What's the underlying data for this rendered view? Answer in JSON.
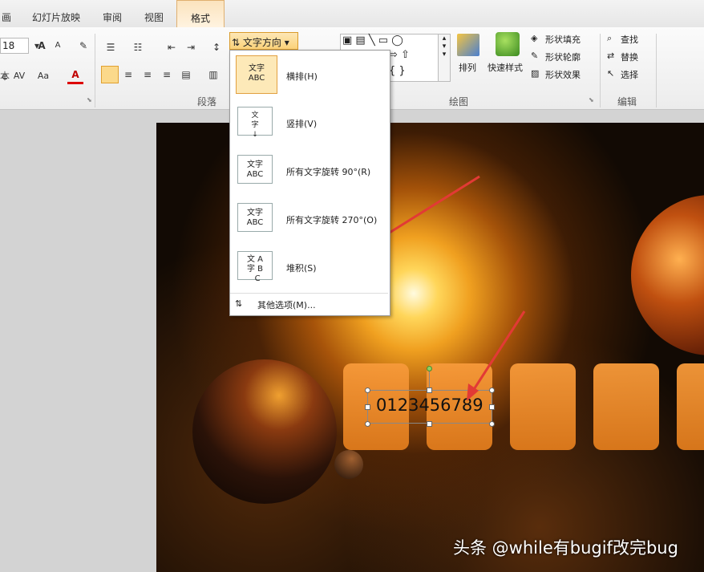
{
  "tabs": [
    "画",
    "幻灯片放映",
    "审阅",
    "视图",
    "格式"
  ],
  "font": {
    "size": "18"
  },
  "groups": {
    "font_partial": "本",
    "paragraph": "段落",
    "drawing": "绘图",
    "editing": "编辑"
  },
  "ribbon": {
    "text_direction": "文字方向",
    "arrange": "排列",
    "quick_styles": "快速样式",
    "shape_fill": "形状填充",
    "shape_outline": "形状轮廓",
    "shape_effects": "形状效果",
    "find": "查找",
    "replace": "替换",
    "select": "选择",
    "font_color_letter": "A",
    "case_label": "Aa"
  },
  "dropdown": {
    "items": [
      {
        "label": "横排(H)",
        "icon_text": "文字 ABC"
      },
      {
        "label": "竖排(V)",
        "icon_text": "文字"
      },
      {
        "label": "所有文字旋转 90°(R)",
        "icon_text": "文字 ABC"
      },
      {
        "label": "所有文字旋转 270°(O)",
        "icon_text": "文字 ABC"
      },
      {
        "label": "堆积(S)",
        "icon_text": "文字 ABC"
      }
    ],
    "more": "其他选项(M)..."
  },
  "slide": {
    "textbox": "0123456789",
    "watermark": "头条 @while有bugif改完bug"
  },
  "colors": {
    "accent": "#fbd27a",
    "arrow": "#e23a35",
    "box": "#f08a2a"
  }
}
